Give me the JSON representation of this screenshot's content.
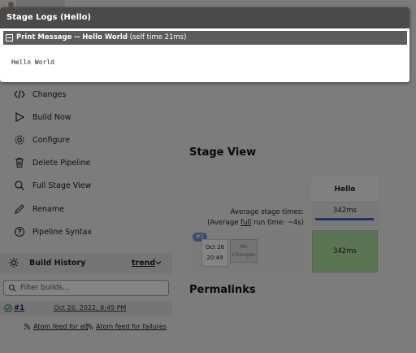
{
  "modal": {
    "title": "Stage Logs (Hello)",
    "step_name": "Print Message -- Hello World",
    "self_time": "(self time 21ms)",
    "log_output": "Hello World"
  },
  "sidebar": {
    "items": [
      {
        "label": "Changes",
        "icon": "code-icon"
      },
      {
        "label": "Build Now",
        "icon": "play-icon"
      },
      {
        "label": "Configure",
        "icon": "gear-icon"
      },
      {
        "label": "Delete Pipeline",
        "icon": "trash-icon"
      },
      {
        "label": "Full Stage View",
        "icon": "search-icon"
      },
      {
        "label": "Rename",
        "icon": "pencil-icon"
      },
      {
        "label": "Pipeline Syntax",
        "icon": "help-icon"
      }
    ],
    "build_history": {
      "title": "Build History",
      "trend_label": "trend",
      "filter_placeholder": "Filter builds...",
      "builds": [
        {
          "number": "#1",
          "date": "Oct 26, 2022, 8:49 PM",
          "status": "success"
        }
      ],
      "feeds": [
        "Atom feed for all",
        "Atom feed for failures"
      ]
    }
  },
  "stage_view": {
    "heading": "Stage View",
    "stage_name": "Hello",
    "avg_label_line1": "Average stage times:",
    "avg_label_line2_pre": "(Average ",
    "avg_label_line2_link": "full",
    "avg_label_line2_post": " run time: ~4s)",
    "avg_time": "342ms",
    "runs": [
      {
        "badge": "#1",
        "date": "Oct 26",
        "time": "20:49",
        "changes": "No Changes",
        "duration": "342ms",
        "status": "success"
      }
    ]
  },
  "permalinks_heading": "Permalinks",
  "colors": {
    "modal_header": "#4a4a4a",
    "stage_success": "#a8d69c",
    "progress_bar": "#3a63a8",
    "overlay": "rgba(0,0,0,0.46)"
  }
}
